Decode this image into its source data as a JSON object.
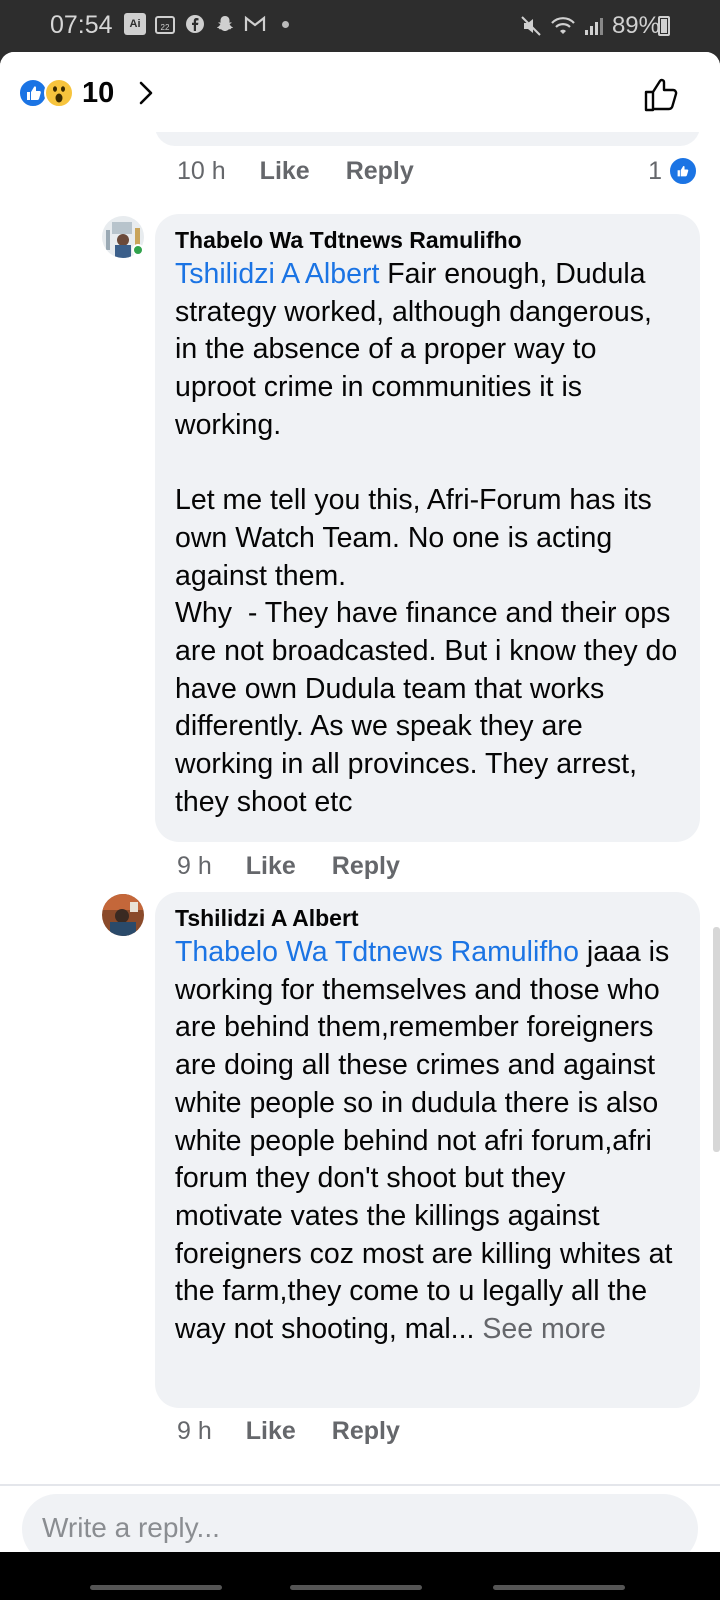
{
  "status_bar": {
    "time": "07:54",
    "icons": [
      "ai-icon",
      "calendar-icon",
      "facebook-icon",
      "snapchat-icon",
      "gmail-icon",
      "dot-icon"
    ],
    "calendar_day": "22",
    "ai_label": "Ai",
    "battery": "89%"
  },
  "header": {
    "reaction_count": "10"
  },
  "prev_comment": {
    "time": "10 h",
    "like": "Like",
    "reply": "Reply",
    "like_count": "1"
  },
  "comments": [
    {
      "author": "Thabelo Wa Tdtnews Ramulifho",
      "mention": "Tshilidzi A Albert",
      "text": " Fair enough, Dudula strategy worked, although dangerous, in the absence of a proper way to uproot crime in communities it is working.\n\nLet me tell you this, Afri-Forum has its own Watch Team. No one is acting against them.\nWhy  - They have finance and their ops are not broadcasted. But i know they do have own Dudula team that works differently. As we speak they are working in all provinces. They arrest, they shoot etc",
      "time": "9 h",
      "like": "Like",
      "reply": "Reply"
    },
    {
      "author": "Tshilidzi A Albert",
      "mention": "Thabelo Wa Tdtnews Ramulifho",
      "text": " jaaa is working for themselves and those who are behind them,remember foreigners are doing all these crimes and against white people so in dudula there is also white people behind not afri forum,afri forum they don't shoot but they motivate vates the killings against foreigners coz most are killing whites at the farm,they come to u legally all the way not shooting, mal... ",
      "see_more": "See more",
      "time": "9 h",
      "like": "Like",
      "reply": "Reply"
    }
  ],
  "reply_box": {
    "placeholder": "Write a reply..."
  },
  "colors": {
    "accent": "#1b74e4",
    "bubble": "#f0f2f5",
    "meta": "#65676b"
  }
}
